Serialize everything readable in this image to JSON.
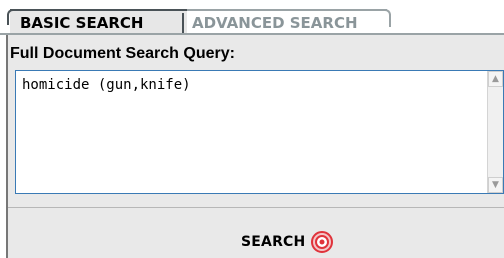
{
  "tabs": {
    "basic": "BASIC SEARCH",
    "advanced": "ADVANCED SEARCH"
  },
  "form": {
    "query_label": "Full Document Search Query:",
    "query_value": "homicide (gun,knife)"
  },
  "actions": {
    "search_label": "SEARCH"
  },
  "icons": {
    "search": "target-icon",
    "scroll_up": "chevron-up-icon",
    "scroll_down": "chevron-down-icon"
  },
  "colors": {
    "panel_bg": "#e9e9e9",
    "active_tab_bg": "#e7e7e7",
    "inactive_tab_text": "#8a9599",
    "textarea_border": "#3a7ab5",
    "search_icon": "#e0333b"
  }
}
